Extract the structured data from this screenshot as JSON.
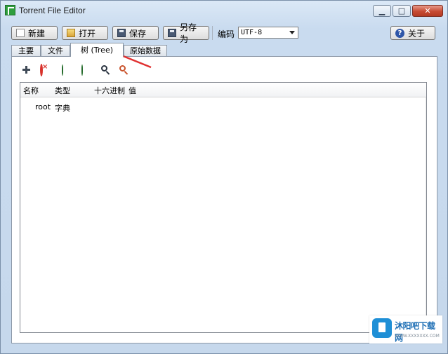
{
  "window": {
    "title": "Torrent File Editor"
  },
  "title_buttons": {
    "minimize": "▁",
    "maximize": "□",
    "close": "✕"
  },
  "toolbar": {
    "new_label": "新建",
    "open_label": "打开",
    "save_label": "保存",
    "save_as_label": "另存为",
    "encoding_label": "编码",
    "encoding_value": "UTF-8",
    "about_label": "关于"
  },
  "tabs": [
    {
      "label": "主要"
    },
    {
      "label": "文件"
    },
    {
      "label": "树 (Tree)",
      "active": true
    },
    {
      "label": "原始数据"
    }
  ],
  "tree_toolbar": {
    "icons": [
      "add-icon",
      "remove-icon",
      "move-up-icon",
      "move-down-icon",
      "search-icon",
      "search-next-icon"
    ]
  },
  "tree": {
    "columns": [
      "名称",
      "类型",
      "十六进制",
      "值"
    ],
    "rows": [
      {
        "name": "root",
        "type": "字典",
        "hex": "",
        "value": ""
      }
    ]
  },
  "colors": {
    "annotation_arrow": "#e03030",
    "title_bar": "#c9dbef"
  },
  "watermark": {
    "main": "沐阳吧下载网",
    "sub": "WWW.XXXXXXX.COM"
  }
}
